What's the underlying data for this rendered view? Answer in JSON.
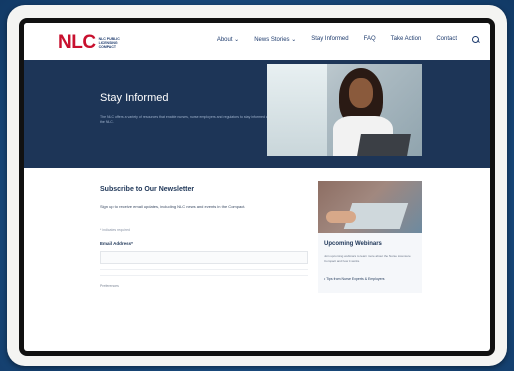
{
  "nav": {
    "logo_text": "NLC",
    "logo_subtitle": "NLC PUBLIC LICENSING COMPACT",
    "items": [
      "About ⌄",
      "News Stories ⌄",
      "Stay Informed",
      "FAQ",
      "Take Action",
      "Contact"
    ],
    "search_icon": "search-icon"
  },
  "hero": {
    "title": "Stay Informed",
    "description": "The NLC offers a variety of resources that enable nurses, nurse employers and regulators to stay informed about the NLC."
  },
  "newsletter": {
    "title": "Subscribe to Our Newsletter",
    "description": "Sign up to receive email updates, including NLC news and events in the Compact.",
    "required_note": "* indicates required",
    "email_label": "Email Address*",
    "continue_text": "Preferences"
  },
  "sidebar": {
    "title": "Upcoming Webinars",
    "description": "Join upcoming webinars to learn more about the Nurse Licensure Compact and how it works.",
    "link_text": "• Tips from Nurse Experts & Employers"
  },
  "colors": {
    "brand_red": "#c8102e",
    "navy": "#1d3557",
    "frame_blue": "#1b4f86"
  }
}
